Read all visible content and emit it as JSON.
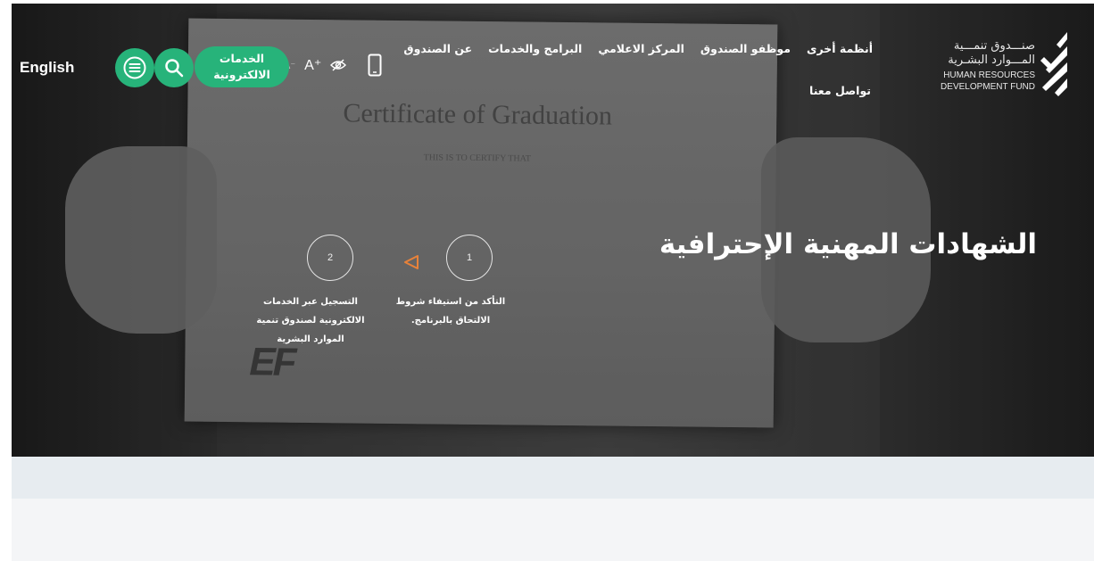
{
  "logo": {
    "arabic_line1": "صنـــدوق تنمـــية",
    "arabic_line2": "المـــوارد البشـرية",
    "english_line1": "HUMAN RESOURCES",
    "english_line2": "DEVELOPMENT FUND"
  },
  "nav": {
    "items": [
      {
        "label": "عن الصندوق"
      },
      {
        "label": "البرامج والخدمات"
      },
      {
        "label": "المركز الاعلامي"
      },
      {
        "label": "موظفو الصندوق"
      },
      {
        "label": "أنظمة أخرى"
      }
    ],
    "contact_label": "تواصل معنا"
  },
  "tools": {
    "font_decrease": "A⁻",
    "font_increase": "A⁺",
    "visibility_icon": "eye-off-icon",
    "mobile_icon": "mobile-icon"
  },
  "eservices": {
    "line1": "الخدمات",
    "line2": "الالكترونية"
  },
  "search": {
    "icon": "search-icon"
  },
  "menu": {
    "icon": "hamburger-icon"
  },
  "language": {
    "label": "English"
  },
  "hero": {
    "title": "الشهادات المهنية الإحترافية",
    "certificate_heading": "Certificate of Graduation",
    "certificate_sub": "THIS IS TO CERTIFY THAT",
    "certificate_logo": "EF",
    "steps": [
      {
        "number": "1",
        "line1": "التأكد من استيفاء شروط",
        "line2": "الالتحاق بالبرنامج."
      },
      {
        "number": "2",
        "line1": "التسجيل عبر الخدمات",
        "line2": "الالكترونية لصندوق تنمية",
        "line3": "الموارد البشرية"
      }
    ]
  },
  "colors": {
    "accent": "#27b37a",
    "band": "#e7ecf0",
    "section": "#f4f5f7",
    "arrow": "#e8823a"
  }
}
